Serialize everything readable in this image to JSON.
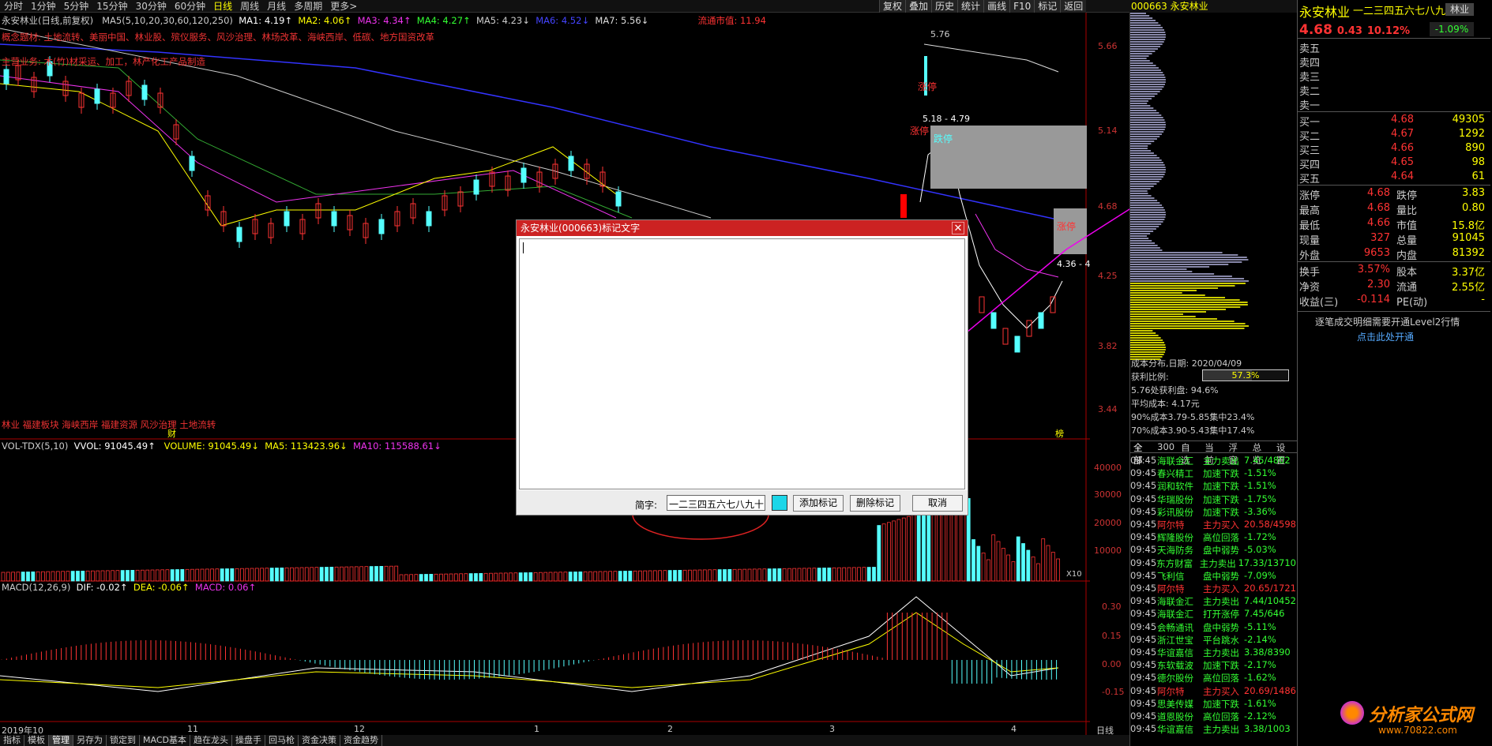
{
  "topbar": {
    "items": [
      "分时",
      "1分钟",
      "5分钟",
      "15分钟",
      "30分钟",
      "60分钟",
      "日线",
      "周线",
      "月线",
      "多周期",
      "更多>"
    ],
    "active_index": 6,
    "right_buttons": [
      "复权",
      "叠加",
      "历史",
      "统计",
      "画线",
      "F10",
      "标记",
      "返回"
    ]
  },
  "chart_header": {
    "title": "永安林业(日线,前复权)",
    "ma_params": "MA5(5,10,20,30,60,120,250)",
    "ma1": "MA1: 4.19↑",
    "ma2": "MA2: 4.06↑",
    "ma3": "MA3: 4.34↑",
    "ma4": "MA4: 4.27↑",
    "ma5": "MA5: 4.23↓",
    "ma6": "MA6: 4.52↓",
    "ma7": "MA7: 5.56↓",
    "float_cap": "流通市值: 11.94",
    "concept": "概念题材: 土地流转、美丽中国、林业股、殡仪服务、风沙治理、林场改革、海峡西岸、低碳、地方国资改革",
    "business": "主营业务: 木(竹)材采运、加工，林产化工产品制造",
    "bottom_labels": "林业 福建板块 海峡西岸 福建资源 风沙治理 土地流转",
    "fin_label": "财",
    "bottom_marker": "榜"
  },
  "annotations": {
    "top_price": "5.76",
    "zt1": "涨停",
    "zt2": "涨停",
    "dt1": "跌停",
    "range_label": "5.18 - 4.79",
    "zt3": "涨停",
    "right_label": "4.36 - 4"
  },
  "price_axis": [
    "5.66",
    "5.14",
    "4.68",
    "4.25",
    "3.82",
    "3.44"
  ],
  "volume": {
    "title": "VOL-TDX(5,10)",
    "vvol": "VVOL: 91045.49↑",
    "volume": "VOLUME: 91045.49↓",
    "ma5": "MA5: 113423.96↓",
    "ma10": "MA10: 115588.61↓",
    "axis": [
      "40000",
      "30000",
      "20000",
      "10000"
    ],
    "unit": "X10"
  },
  "macd": {
    "title": "MACD(12,26,9)",
    "dif": "DIF: -0.02↑",
    "dea": "DEA: -0.06↑",
    "macd": "MACD: 0.06↑",
    "axis": [
      "0.30",
      "0.15",
      "0.00",
      "-0.15"
    ]
  },
  "date_axis": [
    "2019年10",
    "11",
    "12",
    "1",
    "2",
    "3",
    "4"
  ],
  "date_axis_label": "日线",
  "bottom_tabs": [
    "指标",
    "模板",
    "管理",
    "另存为",
    "锁定到",
    "MACD基本",
    "趋在龙头",
    "操盘手",
    "回马枪",
    "资金决策",
    "资金趋势"
  ],
  "bottom_tab_active": 2,
  "dist": {
    "header": "000663 永安林业",
    "date_line": "成本分布,日期: 2020/04/09",
    "profit_label": "获利比例:",
    "profit_value": "57.3%",
    "line1": "5.76处获利盘: 94.6%",
    "line2": "平均成本: 4.17元",
    "line3": "90%成本3.79-5.85集中23.4%",
    "line4": "70%成本3.90-5.43集中17.4%",
    "tabs": [
      "全部",
      "300",
      "自选",
      "当前",
      "浮窗",
      "总览",
      "设置"
    ]
  },
  "stock_list": [
    {
      "t": "09:45",
      "n": "海联金汇",
      "a": "主力卖出",
      "d": "7.45/4802",
      "c": "green"
    },
    {
      "t": "09:45",
      "n": "春兴精工",
      "a": "加速下跌",
      "d": "-1.51%",
      "c": "green"
    },
    {
      "t": "09:45",
      "n": "润和软件",
      "a": "加速下跌",
      "d": "-1.51%",
      "c": "green"
    },
    {
      "t": "09:45",
      "n": "华瑞股份",
      "a": "加速下跌",
      "d": "-1.75%",
      "c": "green"
    },
    {
      "t": "09:45",
      "n": "彩讯股份",
      "a": "加速下跌",
      "d": "-3.36%",
      "c": "green"
    },
    {
      "t": "09:45",
      "n": "阿尔特",
      "a": "主力买入",
      "d": "20.58/4598",
      "c": "red"
    },
    {
      "t": "09:45",
      "n": "辉隆股份",
      "a": "高位回落",
      "d": "-1.72%",
      "c": "green"
    },
    {
      "t": "09:45",
      "n": "天海防务",
      "a": "盘中弱势",
      "d": "-5.03%",
      "c": "green"
    },
    {
      "t": "09:45",
      "n": "东方财富",
      "a": "主力卖出",
      "d": "17.33/13710",
      "c": "green"
    },
    {
      "t": "09:45",
      "n": "飞利信",
      "a": "盘中弱势",
      "d": "-7.09%",
      "c": "green"
    },
    {
      "t": "09:45",
      "n": "阿尔特",
      "a": "主力买入",
      "d": "20.65/1721",
      "c": "red"
    },
    {
      "t": "09:45",
      "n": "海联金汇",
      "a": "主力卖出",
      "d": "7.44/10452",
      "c": "green"
    },
    {
      "t": "09:45",
      "n": "海联金汇",
      "a": "打开涨停",
      "d": "7.45/646",
      "c": "green"
    },
    {
      "t": "09:45",
      "n": "会畅通讯",
      "a": "盘中弱势",
      "d": "-5.11%",
      "c": "green"
    },
    {
      "t": "09:45",
      "n": "浙江世宝",
      "a": "平台跳水",
      "d": "-2.14%",
      "c": "green"
    },
    {
      "t": "09:45",
      "n": "华谊嘉信",
      "a": "主力卖出",
      "d": "3.38/8390",
      "c": "green"
    },
    {
      "t": "09:45",
      "n": "东软载波",
      "a": "加速下跌",
      "d": "-2.17%",
      "c": "green"
    },
    {
      "t": "09:45",
      "n": "德尔股份",
      "a": "高位回落",
      "d": "-1.62%",
      "c": "green"
    },
    {
      "t": "09:45",
      "n": "阿尔特",
      "a": "主力买入",
      "d": "20.69/1486",
      "c": "red"
    },
    {
      "t": "09:45",
      "n": "思美传媒",
      "a": "加速下跌",
      "d": "-1.61%",
      "c": "green"
    },
    {
      "t": "09:45",
      "n": "道恩股份",
      "a": "高位回落",
      "d": "-2.12%",
      "c": "green"
    },
    {
      "t": "09:45",
      "n": "华谊嘉信",
      "a": "主力卖出",
      "d": "3.38/1003",
      "c": "green"
    }
  ],
  "info": {
    "name": "永安林业",
    "header_text": "一二三四五六七八九十",
    "industry": "林业",
    "industry_change": "-1.09%",
    "price": "4.68",
    "change": "0.43",
    "change_pct": "10.12%",
    "sells": [
      "卖五",
      "卖四",
      "卖三",
      "卖二",
      "卖一"
    ],
    "buys": [
      {
        "l": "买一",
        "p": "4.68",
        "v": "49305"
      },
      {
        "l": "买二",
        "p": "4.67",
        "v": "1292"
      },
      {
        "l": "买三",
        "p": "4.66",
        "v": "890"
      },
      {
        "l": "买四",
        "p": "4.65",
        "v": "98"
      },
      {
        "l": "买五",
        "p": "4.64",
        "v": "61"
      }
    ],
    "stats": [
      {
        "a": "涨停",
        "av": "4.68",
        "b": "跌停",
        "bv": "3.83"
      },
      {
        "a": "最高",
        "av": "4.68",
        "b": "量比",
        "bv": "0.80"
      },
      {
        "a": "最低",
        "av": "4.66",
        "b": "市值",
        "bv": "15.8亿"
      },
      {
        "a": "现量",
        "av": "327",
        "b": "总量",
        "bv": "91045"
      },
      {
        "a": "外盘",
        "av": "9653",
        "b": "内盘",
        "bv": "81392"
      }
    ],
    "stats2": [
      {
        "a": "换手",
        "av": "3.57%",
        "b": "股本",
        "bv": "3.37亿"
      },
      {
        "a": "净资",
        "av": "2.30",
        "b": "流通",
        "bv": "2.55亿"
      },
      {
        "a": "收益(三)",
        "av": "-0.114",
        "b": "PE(动)",
        "bv": "-"
      }
    ],
    "level2_note": "逐笔成交明细需要开通Level2行情",
    "level2_link": "点击此处开通"
  },
  "dialog": {
    "title": "永安林业(000663)标记文字",
    "short_label": "简字:",
    "short_value": "一二三四五六七八九十",
    "add_btn": "添加标记",
    "del_btn": "删除标记",
    "cancel_btn": "取消",
    "close": "✕"
  },
  "watermark": "分析家公式网",
  "watermark_url": "www.70822.com"
}
